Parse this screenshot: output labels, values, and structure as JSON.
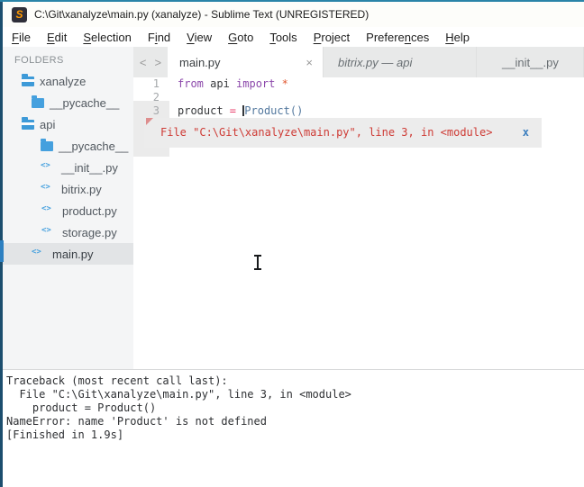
{
  "window": {
    "title": "C:\\Git\\xanalyze\\main.py (xanalyze) - Sublime Text (UNREGISTERED)",
    "app_icon": "sublime-text-logo",
    "app_icon_letter": "S"
  },
  "menu": {
    "items": [
      {
        "label": "File",
        "u": 0
      },
      {
        "label": "Edit",
        "u": 0
      },
      {
        "label": "Selection",
        "u": 0
      },
      {
        "label": "Find",
        "u": 1
      },
      {
        "label": "View",
        "u": 0
      },
      {
        "label": "Goto",
        "u": 0
      },
      {
        "label": "Tools",
        "u": 0
      },
      {
        "label": "Project",
        "u": 0
      },
      {
        "label": "Preferences",
        "u": 7
      },
      {
        "label": "Help",
        "u": 0
      }
    ]
  },
  "sidebar": {
    "header": "FOLDERS",
    "items": [
      {
        "label": "xanalyze",
        "icon": "folder-open-icon",
        "selected": false
      },
      {
        "label": "__pycache__",
        "icon": "folder-icon",
        "selected": false
      },
      {
        "label": "api",
        "icon": "folder-open-icon",
        "selected": false
      },
      {
        "label": "__pycache__",
        "icon": "folder-icon",
        "selected": false
      },
      {
        "label": "__init__.py",
        "icon": "code-file-icon",
        "selected": false
      },
      {
        "label": "bitrix.py",
        "icon": "code-file-icon",
        "selected": false
      },
      {
        "label": "product.py",
        "icon": "code-file-icon",
        "selected": false
      },
      {
        "label": "storage.py",
        "icon": "code-file-icon",
        "selected": false
      },
      {
        "label": "main.py",
        "icon": "code-file-icon",
        "selected": true
      }
    ]
  },
  "tabs": {
    "nav_back": "<",
    "nav_forward": ">",
    "items": [
      {
        "label": "main.py",
        "state": "active",
        "close": "×"
      },
      {
        "label": "bitrix.py — api",
        "state": "inactive-preview"
      },
      {
        "label": "__init__.py",
        "state": "inactive"
      }
    ]
  },
  "editor": {
    "lines": [
      {
        "num": "1",
        "tokens": [
          {
            "t": "from",
            "c": "keyword"
          },
          {
            "t": " api ",
            "c": "plain"
          },
          {
            "t": "import",
            "c": "keyword"
          },
          {
            "t": " ",
            "c": "plain"
          },
          {
            "t": "*",
            "c": "star"
          }
        ]
      },
      {
        "num": "2",
        "tokens": []
      },
      {
        "num": "3",
        "tokens": [
          {
            "t": "product ",
            "c": "plain"
          },
          {
            "t": "=",
            "c": "operator"
          },
          {
            "t": " ",
            "c": "plain"
          },
          {
            "t": "Product()",
            "c": "type"
          }
        ]
      }
    ],
    "phantom": {
      "text": "File \"C:\\Git\\xanalyze\\main.py\", line 3, in <module>",
      "close": "x"
    }
  },
  "console": {
    "lines": [
      "Traceback (most recent call last):",
      "  File \"C:\\Git\\xanalyze\\main.py\", line 3, in <module>",
      "    product = Product()",
      "NameError: name 'Product' is not defined",
      "[Finished in 1.9s]"
    ]
  },
  "colors": {
    "window_border_top": "#2a84a8",
    "window_border_left": "#1c4e6e",
    "selection_accent_blue": "#2d80c1",
    "folder_blue": "#45a0de",
    "keyword_purple": "#8c49ab",
    "operator_pink": "#e83f6b",
    "type_blue": "#53789e",
    "star_orange": "#e0572f",
    "error_red": "#ce3a34",
    "phantom_close_blue": "#3a7dbe",
    "phantom_bg": "#ececec",
    "sidebar_bg": "#f4f5f6",
    "tabbar_bg": "#e8e9e9",
    "logo_orange": "#ff9800"
  }
}
